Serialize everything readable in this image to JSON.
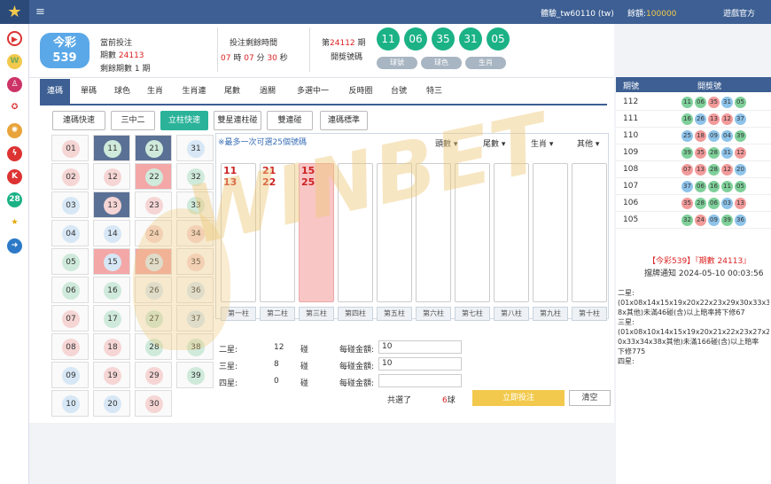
{
  "topbar": {
    "account_label": "體驗_tw60110 (tw)",
    "balance_label": "餘額:",
    "balance_value": "100000",
    "official_label": "遊戲官方"
  },
  "sidebar_icons": [
    "play-icon",
    "w-icon",
    "person-icon",
    "star-icon",
    "wheel-icon",
    "lightning-icon",
    "k-icon",
    "28-icon",
    "star2-icon",
    "share-icon"
  ],
  "sidebar_28": "28",
  "header": {
    "brand_line1": "今彩",
    "brand_line2": "539",
    "current_bet": "當前投注",
    "period_label": "期數",
    "period_value": "24113",
    "remaining_label": "剩餘期數 1 期",
    "countdown_title": "投注剩餘時間",
    "countdown": {
      "h": "07",
      "hu": "時",
      "m": "07",
      "mu": "分",
      "s": "30",
      "su": "秒"
    },
    "draw_prefix": "第",
    "draw_period": "24112",
    "draw_suffix": "期",
    "draw_label": "開獎號碼",
    "draw_balls": [
      "11",
      "06",
      "35",
      "31",
      "05"
    ],
    "pills": [
      "球號",
      "球色",
      "生肖"
    ]
  },
  "tabs": [
    "連碼",
    "單碼",
    "球色",
    "生肖",
    "生肖連",
    "尾數",
    "過關",
    "多選中一",
    "反時圈",
    "台號",
    "特三"
  ],
  "subtabs": [
    "連碼快速",
    "三中二",
    "立柱快速",
    "雙星連柱碰",
    "雙連碰",
    "連碼標準"
  ],
  "grid": [
    [
      "01",
      "11",
      "21",
      "31"
    ],
    [
      "02",
      "12",
      "22",
      "32"
    ],
    [
      "03",
      "13",
      "23",
      "33"
    ],
    [
      "04",
      "14",
      "24",
      "34"
    ],
    [
      "05",
      "15",
      "25",
      "35"
    ],
    [
      "06",
      "16",
      "26",
      "36"
    ],
    [
      "07",
      "17",
      "27",
      "37"
    ],
    [
      "08",
      "18",
      "28",
      "38"
    ],
    [
      "09",
      "19",
      "29",
      "39"
    ],
    [
      "10",
      "20",
      "30"
    ]
  ],
  "note": "※最多一次可選25個號碼",
  "dropdowns": [
    "頭數",
    "尾數",
    "生肖",
    "其他"
  ],
  "columns": [
    [
      "11",
      "13"
    ],
    [
      "21",
      "22"
    ],
    [
      "15",
      "25"
    ],
    [],
    [],
    [],
    [],
    [],
    [],
    []
  ],
  "column_labels": [
    "第一柱",
    "第二柱",
    "第三柱",
    "第四柱",
    "第五柱",
    "第六柱",
    "第七柱",
    "第八柱",
    "第九柱",
    "第十柱"
  ],
  "stats": [
    {
      "label": "二星:",
      "count": "12",
      "unit": "碰",
      "amount_label": "每碰金額:",
      "amount": "10"
    },
    {
      "label": "三星:",
      "count": "8",
      "unit": "碰",
      "amount_label": "每碰金額:",
      "amount": "10"
    },
    {
      "label": "四星:",
      "count": "0",
      "unit": "碰",
      "amount_label": "每碰金額:",
      "amount": ""
    }
  ],
  "total_label": "共選了",
  "total_value": "6",
  "total_unit": "球",
  "place_bet": "立即投注",
  "clear": "清空",
  "results": {
    "head_period": "期號",
    "head_numbers": "開獎號",
    "rows": [
      {
        "p": "112",
        "n": [
          "11",
          "06",
          "35",
          "31",
          "05"
        ]
      },
      {
        "p": "111",
        "n": [
          "16",
          "26",
          "13",
          "12",
          "37"
        ]
      },
      {
        "p": "110",
        "n": [
          "25",
          "18",
          "09",
          "04",
          "39"
        ]
      },
      {
        "p": "109",
        "n": [
          "39",
          "35",
          "28",
          "31",
          "12"
        ]
      },
      {
        "p": "108",
        "n": [
          "07",
          "13",
          "28",
          "12",
          "20"
        ]
      },
      {
        "p": "107",
        "n": [
          "37",
          "06",
          "16",
          "11",
          "05"
        ]
      },
      {
        "p": "106",
        "n": [
          "35",
          "28",
          "06",
          "03",
          "13"
        ]
      },
      {
        "p": "105",
        "n": [
          "32",
          "24",
          "09",
          "39",
          "36"
        ]
      }
    ]
  },
  "announce": {
    "title": "【今彩539】『期數 24113』",
    "notice_label": "擋牌通知",
    "notice_time": "2024-05-10 00:03:56",
    "body": [
      "二星:",
      "(01x08x14x15x19x20x22x23x29x30x33x34",
      "8x其他)未滿46碰(含)以上賠率將下修67",
      "三星:",
      "(01x08x10x14x15x19x20x21x22x23x27x29",
      "0x33x34x38x其他)未滿166碰(含)以上賠率",
      "下修775",
      "四星:"
    ]
  },
  "watermark": "WINBET"
}
